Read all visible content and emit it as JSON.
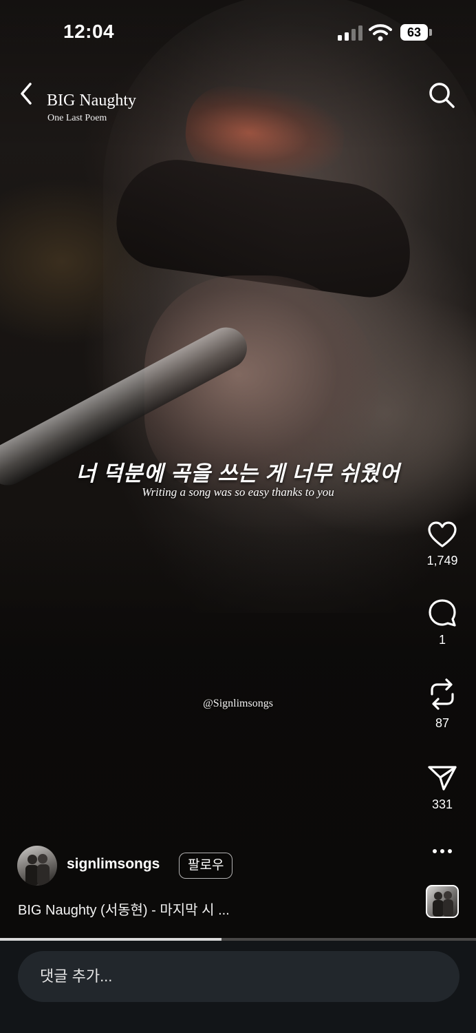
{
  "status_bar": {
    "time": "12:04",
    "battery": "63"
  },
  "header": {
    "title": "BIG Naughty",
    "subtitle": "One Last Poem"
  },
  "captions": {
    "korean": "너 덕분에 곡을 쓰는 게 너무 쉬웠어",
    "english": "Writing a song was so easy thanks to you",
    "watermark": "@Signlimsongs"
  },
  "actions": {
    "likes": "1,749",
    "comments": "1",
    "reposts": "87",
    "shares": "331"
  },
  "author": {
    "username": "signlimsongs",
    "follow_label": "팔로우"
  },
  "video_caption": "BIG Naughty (서동현) - 마지막 시 ...",
  "progress": {
    "fraction": 0.466
  },
  "comment_bar": {
    "placeholder": "댓글 추가..."
  },
  "icons": [
    "back-icon",
    "search-icon",
    "heart-icon",
    "comment-icon",
    "repost-icon",
    "share-icon",
    "more-icon"
  ]
}
